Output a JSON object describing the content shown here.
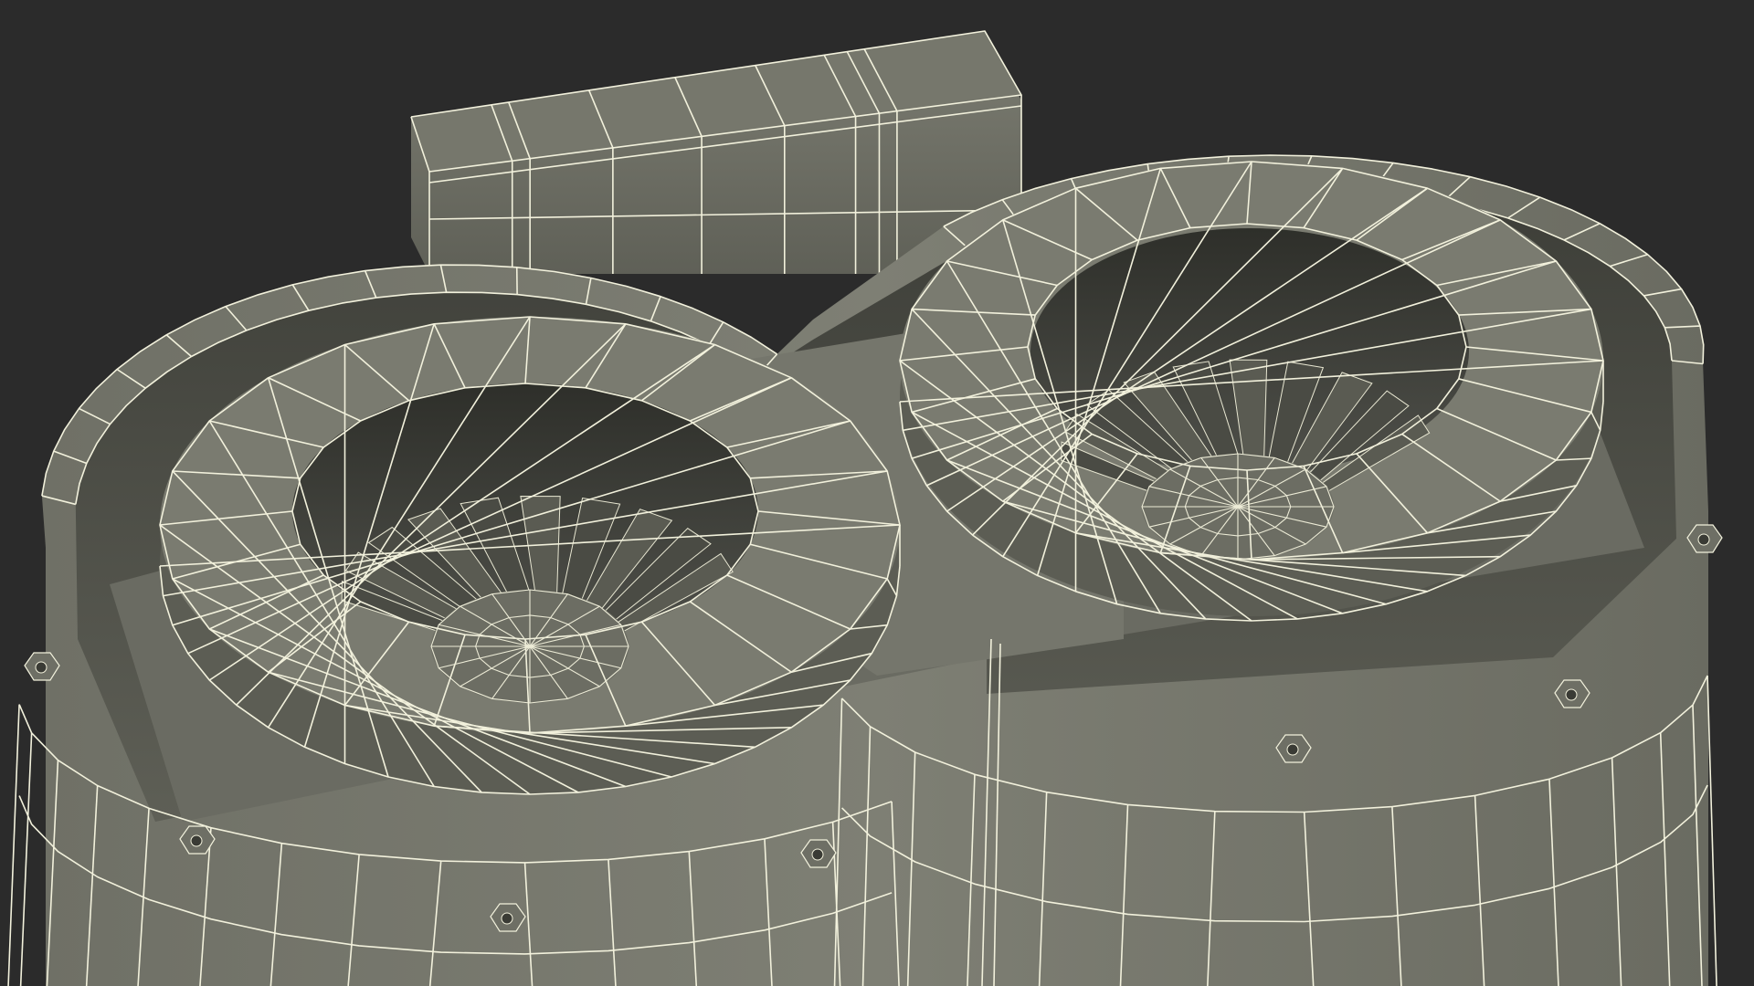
{
  "scene": {
    "background_color": "#2b2b2b",
    "surface_color": "#7b7c71",
    "surface_dark_color": "#55564d",
    "surface_shadow_color": "#3f403a",
    "wireframe_color": "#f2f1dc",
    "left_fan_blade_count": 10,
    "right_fan_blade_count": 10,
    "ring_segment_count": 24,
    "wall_segment_count": 26
  }
}
